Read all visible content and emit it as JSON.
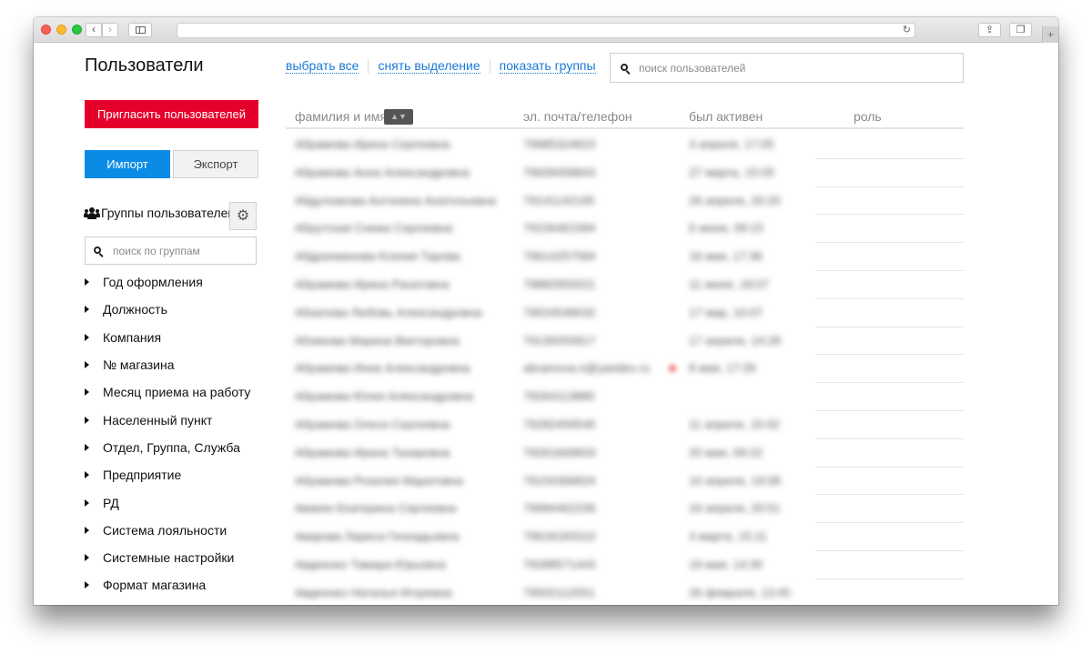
{
  "page": {
    "title": "Пользователи"
  },
  "sidebar": {
    "invite_label": "Пригласить пользователей",
    "import_label": "Импорт",
    "export_label": "Экспорт",
    "groups_title": "Группы пользователей",
    "group_search_placeholder": "поиск по группам",
    "groups": [
      "Год оформления",
      "Должность",
      "Компания",
      "№ магазина",
      "Месяц приема на работу",
      "Населенный пункт",
      "Отдел, Группа, Служба",
      "Предприятие",
      "РД",
      "Система лояльности",
      "Системные настройки",
      "Формат магазина"
    ]
  },
  "actions": {
    "select_all": "выбрать все",
    "clear_selection": "снять выделение",
    "show_groups": "показать группы"
  },
  "user_search": {
    "placeholder": "поиск пользователей"
  },
  "table": {
    "columns": [
      "фамилия и имя",
      "эл. почта/телефон",
      "был активен",
      "роль"
    ],
    "rows": [
      {
        "name": "Абрамова Ирина Сергеевна",
        "contact": "79985324815",
        "active": "3 апреля, 17:05"
      },
      {
        "name": "Абрамова Анна Александровна",
        "contact": "79928458843",
        "active": "27 марта, 15:05"
      },
      {
        "name": "Абдулхакова Антонина Анатольевна",
        "contact": "79141142195",
        "active": "26 апреля, 20:20"
      },
      {
        "name": "Абрутская Снежа Сергеевна",
        "contact": "79156461584",
        "active": "6 июня, 09:15"
      },
      {
        "name": "Абдрахманова Ксения Тарова",
        "contact": "79614257584",
        "active": "16 мая, 17:36"
      },
      {
        "name": "Абрамова Ирина Рахатовна",
        "contact": "79882950021",
        "active": "11 июня, 18:07"
      },
      {
        "name": "Абзалова Любовь Александровна",
        "contact": "79024548032",
        "active": "17 мар, 10:07"
      },
      {
        "name": "Абзякова Марина Викторовна",
        "contact": "79135055817",
        "active": "17 апреля, 14:28"
      },
      {
        "name": "Абрамова Инна Александровна",
        "contact": "abramova.n@yandex.ru",
        "active": "8 мая, 17:35"
      },
      {
        "name": "Абрамова Юлия Александровна",
        "contact": "79264113880",
        "active": ""
      },
      {
        "name": "Абрамова Олеся Сергеевна",
        "contact": "79282459545",
        "active": "11 апреля, 15:02"
      },
      {
        "name": "Абрамова Ирина Тахировна",
        "contact": "79261669833",
        "active": "20 мая, 09:22"
      },
      {
        "name": "Абрамова Розалия Маратовна",
        "contact": "79154366824",
        "active": "10 апреля, 19:08"
      },
      {
        "name": "Авакян Екатерина Сергеевна",
        "contact": "79994462236",
        "active": "16 апреля, 20:51"
      },
      {
        "name": "Аварова Лариса Геннадьевна",
        "contact": "79618183310",
        "active": "3 марта, 15:11"
      },
      {
        "name": "Авдеенко Тамара Юрьевна",
        "contact": "79288571443",
        "active": "19 мая, 14:30"
      },
      {
        "name": "Авдеенко Наталья Игоревна",
        "contact": "79502112051",
        "active": "26 февраля, 13:45"
      }
    ]
  }
}
